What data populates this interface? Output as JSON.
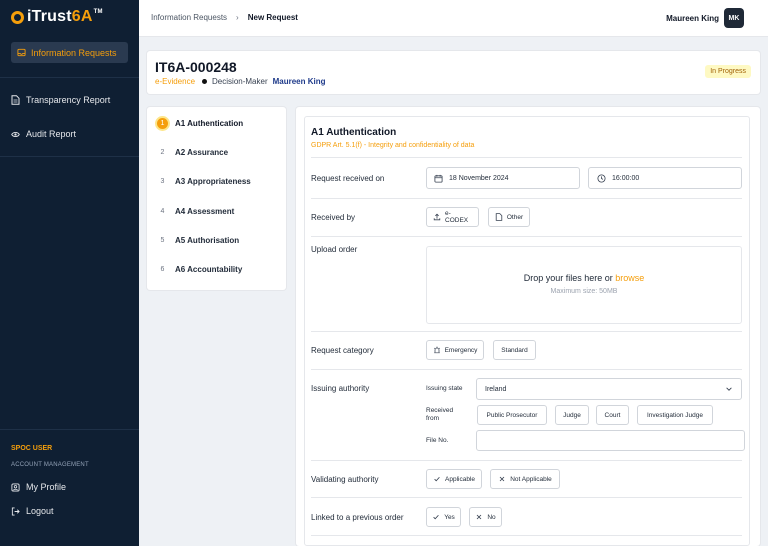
{
  "app": {
    "logo_prefix": "iTrust",
    "logo_suffix": "6A",
    "logo_tm": "TM"
  },
  "sidebar": {
    "active_item": "Information Requests",
    "items": [
      {
        "label": "Transparency Report",
        "icon": "document-icon"
      },
      {
        "label": "Audit Report",
        "icon": "eye-icon"
      }
    ],
    "section_title": "SPOC USER",
    "account_label": "ACCOUNT MANAGEMENT",
    "account_items": [
      {
        "label": "My Profile",
        "icon": "profile-icon"
      },
      {
        "label": "Logout",
        "icon": "logout-icon"
      }
    ]
  },
  "topbar": {
    "breadcrumb_root": "Information Requests",
    "breadcrumb_sep": "›",
    "breadcrumb_current": "New Request",
    "user_name": "Maureen King",
    "user_initials": "MK"
  },
  "request": {
    "id": "IT6A-000248",
    "type": "e-Evidence",
    "role": "Decision-Maker",
    "owner": "Maureen King",
    "status": "In Progress"
  },
  "steps": [
    {
      "num": "1",
      "label": "A1 Authentication",
      "active": true
    },
    {
      "num": "2",
      "label": "A2 Assurance"
    },
    {
      "num": "3",
      "label": "A3 Appropriateness"
    },
    {
      "num": "4",
      "label": "A4 Assessment"
    },
    {
      "num": "5",
      "label": "A5 Authorisation"
    },
    {
      "num": "6",
      "label": "A6 Accountability"
    }
  ],
  "form": {
    "title": "A1 Authentication",
    "subtitle": "GDPR Art. 5.1(f) - Integrity and confidentiality of data",
    "received_on": {
      "label": "Request received on",
      "date": "18 November 2024",
      "time": "16:00:00"
    },
    "received_by": {
      "label": "Received by",
      "options": [
        "e-CODEX",
        "Other"
      ]
    },
    "upload": {
      "label": "Upload order",
      "drop_text": "Drop your files here or ",
      "browse": "browse",
      "max_size": "Maximum size: 50MB"
    },
    "category": {
      "label": "Request category",
      "options": [
        "Emergency",
        "Standard"
      ]
    },
    "issuing": {
      "label": "Issuing authority",
      "state_label": "Issuing state",
      "state_value": "Ireland",
      "received_from_label_1": "Received",
      "received_from_label_2": "from",
      "received_from_options": [
        "Public Prosecutor",
        "Judge",
        "Court",
        "Investigation Judge"
      ],
      "file_no_label": "File No.",
      "file_no_value": ""
    },
    "validating": {
      "label": "Validating authority",
      "options": [
        "Applicable",
        "Not Applicable"
      ]
    },
    "linked": {
      "label": "Linked to a previous order",
      "options": [
        "Yes",
        "No"
      ]
    }
  },
  "colors": {
    "accent": "#f59e0b",
    "sidebar": "#0f1f33",
    "status_bg": "#fef9c3",
    "status_fg": "#a16207"
  }
}
